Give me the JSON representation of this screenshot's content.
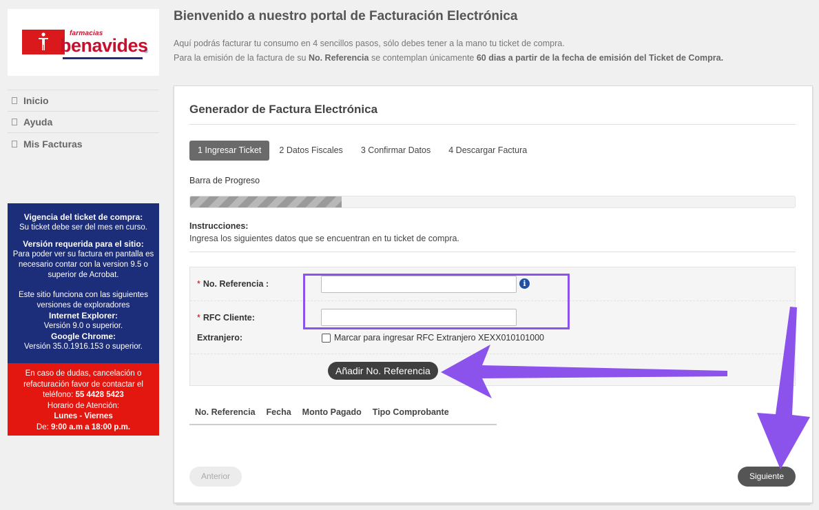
{
  "brand": {
    "name": "benavides",
    "small": "farmacias",
    "reg": "®"
  },
  "sidebar": {
    "items": [
      {
        "label": "Inicio"
      },
      {
        "label": "Ayuda"
      },
      {
        "label": "Mis Facturas"
      }
    ],
    "info_blue": {
      "vigencia_title": "Vigencia del ticket de compra:",
      "vigencia_text": "Su ticket debe ser del mes en curso.",
      "version_title": "Versión requerida para el sitio:",
      "version_text": "Para poder ver su factura en pantalla es necesario contar con la version 9.5 o superior de Acrobat.",
      "browsers_text": "Este sitio funciona con las siguientes versiones de exploradores",
      "ie_title": "Internet Explorer:",
      "ie_text": "Versión 9.0 o superior.",
      "chrome_title": "Google Chrome:",
      "chrome_text": "Versión 35.0.1916.153 o superior."
    },
    "info_red": {
      "text": "En caso de dudas, cancelación o refacturación favor de contactar el teléfono:",
      "phone": "55 4428 5423",
      "hours_label": "Horario de Atención:",
      "days": "Lunes - Viernes",
      "de_label": "De:",
      "hours": "9:00 a.m a 18:00 p.m."
    }
  },
  "header": {
    "title": "Bienvenido a nuestro portal de Facturación Electrónica",
    "intro1": "Aquí podrás facturar tu consumo en 4 sencillos pasos, sólo debes tener a la mano tu ticket de compra.",
    "intro2_a": "Para la emisión de la factura de su",
    "intro2_b": "No. Referencia",
    "intro2_c": "se contemplan únicamente",
    "intro2_d": "60 dias a partir de la fecha de emisión del Ticket de Compra."
  },
  "panel": {
    "title": "Generador de Factura Electrónica",
    "steps": [
      {
        "label": "1 Ingresar Ticket",
        "active": true
      },
      {
        "label": "2 Datos Fiscales",
        "active": false
      },
      {
        "label": "3 Confirmar Datos",
        "active": false
      },
      {
        "label": "4 Descargar Factura",
        "active": false
      }
    ],
    "progress_label": "Barra de Progreso",
    "progress": 0.25,
    "instructions_title": "Instrucciones:",
    "instructions_text": "Ingresa los siguientes datos que se encuentran en tu ticket de compra.",
    "form": {
      "ref_label": "No. Referencia :",
      "ref_value": "",
      "rfc_label": "RFC Cliente:",
      "rfc_value": "",
      "ext_label": "Extranjero:",
      "ext_checkbox_label": "Marcar para ingresar RFC Extranjero XEXX010101000",
      "required_mark": "*",
      "info_icon": "i",
      "add_button": "Añadir No. Referencia"
    },
    "table_headers": [
      "No. Referencia",
      "Fecha",
      "Monto Pagado",
      "Tipo Comprobante"
    ],
    "prev_button": "Anterior",
    "next_button": "Siguiente"
  },
  "colors": {
    "blue": "#1c2d7a",
    "red": "#e3170f",
    "annotation": "#8c52ec"
  }
}
